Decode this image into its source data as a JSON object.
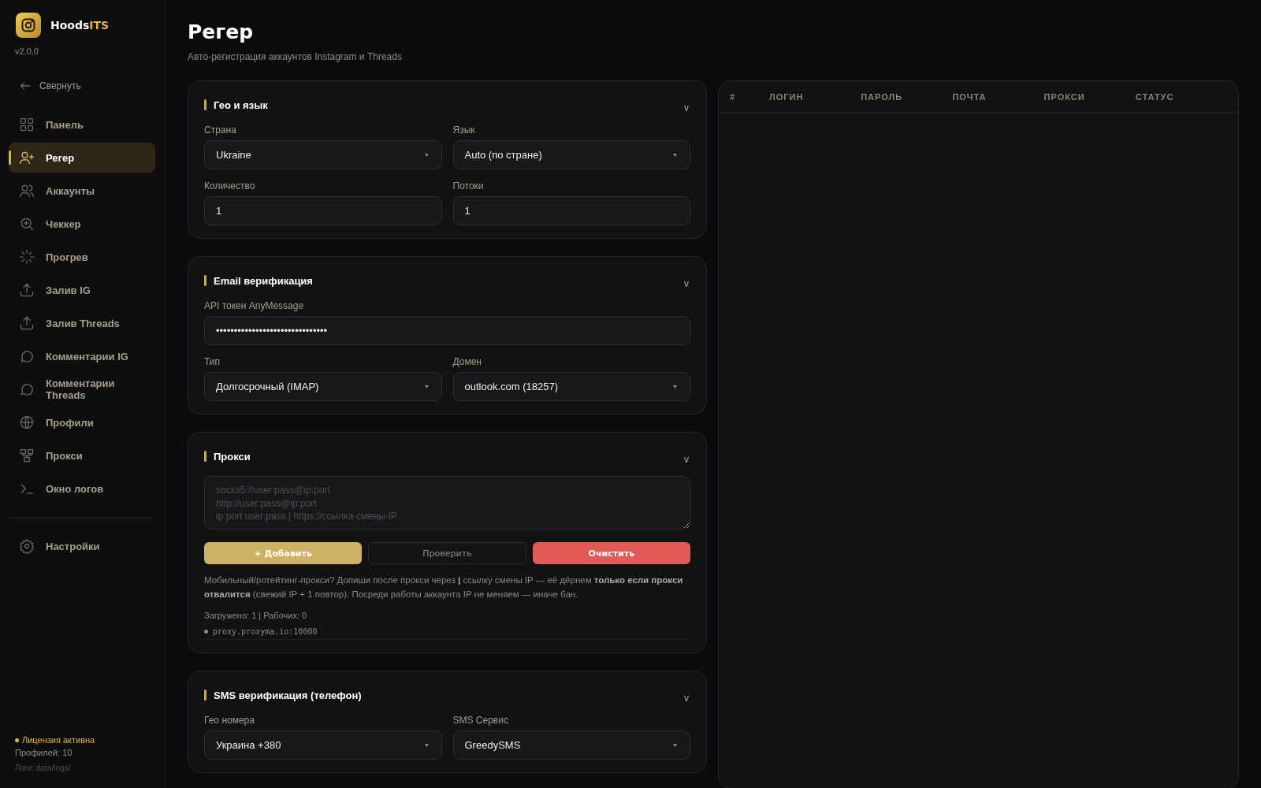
{
  "app": {
    "name_main": "Hoods",
    "name_accent": "ITS",
    "version": "v2.0.0"
  },
  "sidebar": {
    "collapse": "Свернуть",
    "items": [
      {
        "label": "Панель",
        "selected": false
      },
      {
        "label": "Регер",
        "selected": true
      },
      {
        "label": "Аккаунты",
        "selected": false
      },
      {
        "label": "Чеккер",
        "selected": false
      },
      {
        "label": "Прогрев",
        "selected": false
      },
      {
        "label": "Залив IG",
        "selected": false
      },
      {
        "label": "Залив Threads",
        "selected": false
      },
      {
        "label": "Комментарии IG",
        "selected": false
      },
      {
        "label": "Комментарии Threads",
        "selected": false
      },
      {
        "label": "Профили",
        "selected": false
      },
      {
        "label": "Прокси",
        "selected": false
      },
      {
        "label": "Окно логов",
        "selected": false
      }
    ],
    "settings": {
      "label": "Настройки",
      "selected": false
    },
    "license": "Лицензия активна",
    "profiles": "Профилей: 10",
    "logs": "Логи: data/logs/"
  },
  "page": {
    "title": "Регер",
    "subtitle": "Авто-регистрация аккаунтов Instagram и Threads"
  },
  "cards": [
    {
      "title": "Гео и язык",
      "toggle": "v",
      "fields": [
        {
          "kind": "select",
          "label": "Страна",
          "value": "Ukraine"
        },
        {
          "kind": "select",
          "label": "Язык",
          "value": "Auto (по стране)"
        },
        {
          "kind": "input",
          "label": "Количество",
          "value": "1"
        },
        {
          "kind": "input",
          "label": "Потоки",
          "value": "1"
        }
      ]
    },
    {
      "title": "Email верификация",
      "toggle": "v",
      "fields": [
        {
          "kind": "wide",
          "label": "API токен AnyMessage",
          "value": "•••••••••••••••••••••••••••••••"
        },
        {
          "kind": "select",
          "label": "Тип",
          "value": "Долгосрочный (IMAP)"
        },
        {
          "kind": "select",
          "label": "Домен",
          "value": "outlook.com (18257)"
        }
      ]
    },
    {
      "title": "Прокси",
      "toggle": "v",
      "fields": [
        {
          "kind": "textarea",
          "placeholder": "socks5://user:pass@ip:port\nhttp://user:pass@ip:port\nip:port:user:pass | https://ссылка-смены-IP"
        }
      ],
      "buttons": [
        {
          "kind": "primary",
          "label": "+ Добавить"
        },
        {
          "kind": "secondary",
          "label": "Проверить"
        },
        {
          "kind": "danger",
          "label": "Очистить"
        }
      ],
      "note": "Мобильный/ротейтинг-прокси? Допиши после прокси через **|** ссылку смены IP — её дёрнем **только если прокси отвалится** (свежий IP + 1 повтор). Посреди работы аккаунта IP не меняем — иначе бан.",
      "stats": "Загружено: 1 | Рабочих: 0",
      "proxies": [
        "proxy.proxyma.io:10000"
      ]
    },
    {
      "title": "SMS верификация (телефон)",
      "toggle": "v",
      "fields": [
        {
          "kind": "select",
          "label": "Гео номера",
          "value": "Украина +380"
        },
        {
          "kind": "select",
          "label": "SMS Сервис",
          "value": "GreedySMS"
        }
      ]
    }
  ],
  "table": {
    "columns": [
      "#",
      "ЛОГИН",
      "ПАРОЛЬ",
      "ПОЧТА",
      "ПРОКСИ",
      "СТАТУС"
    ]
  }
}
